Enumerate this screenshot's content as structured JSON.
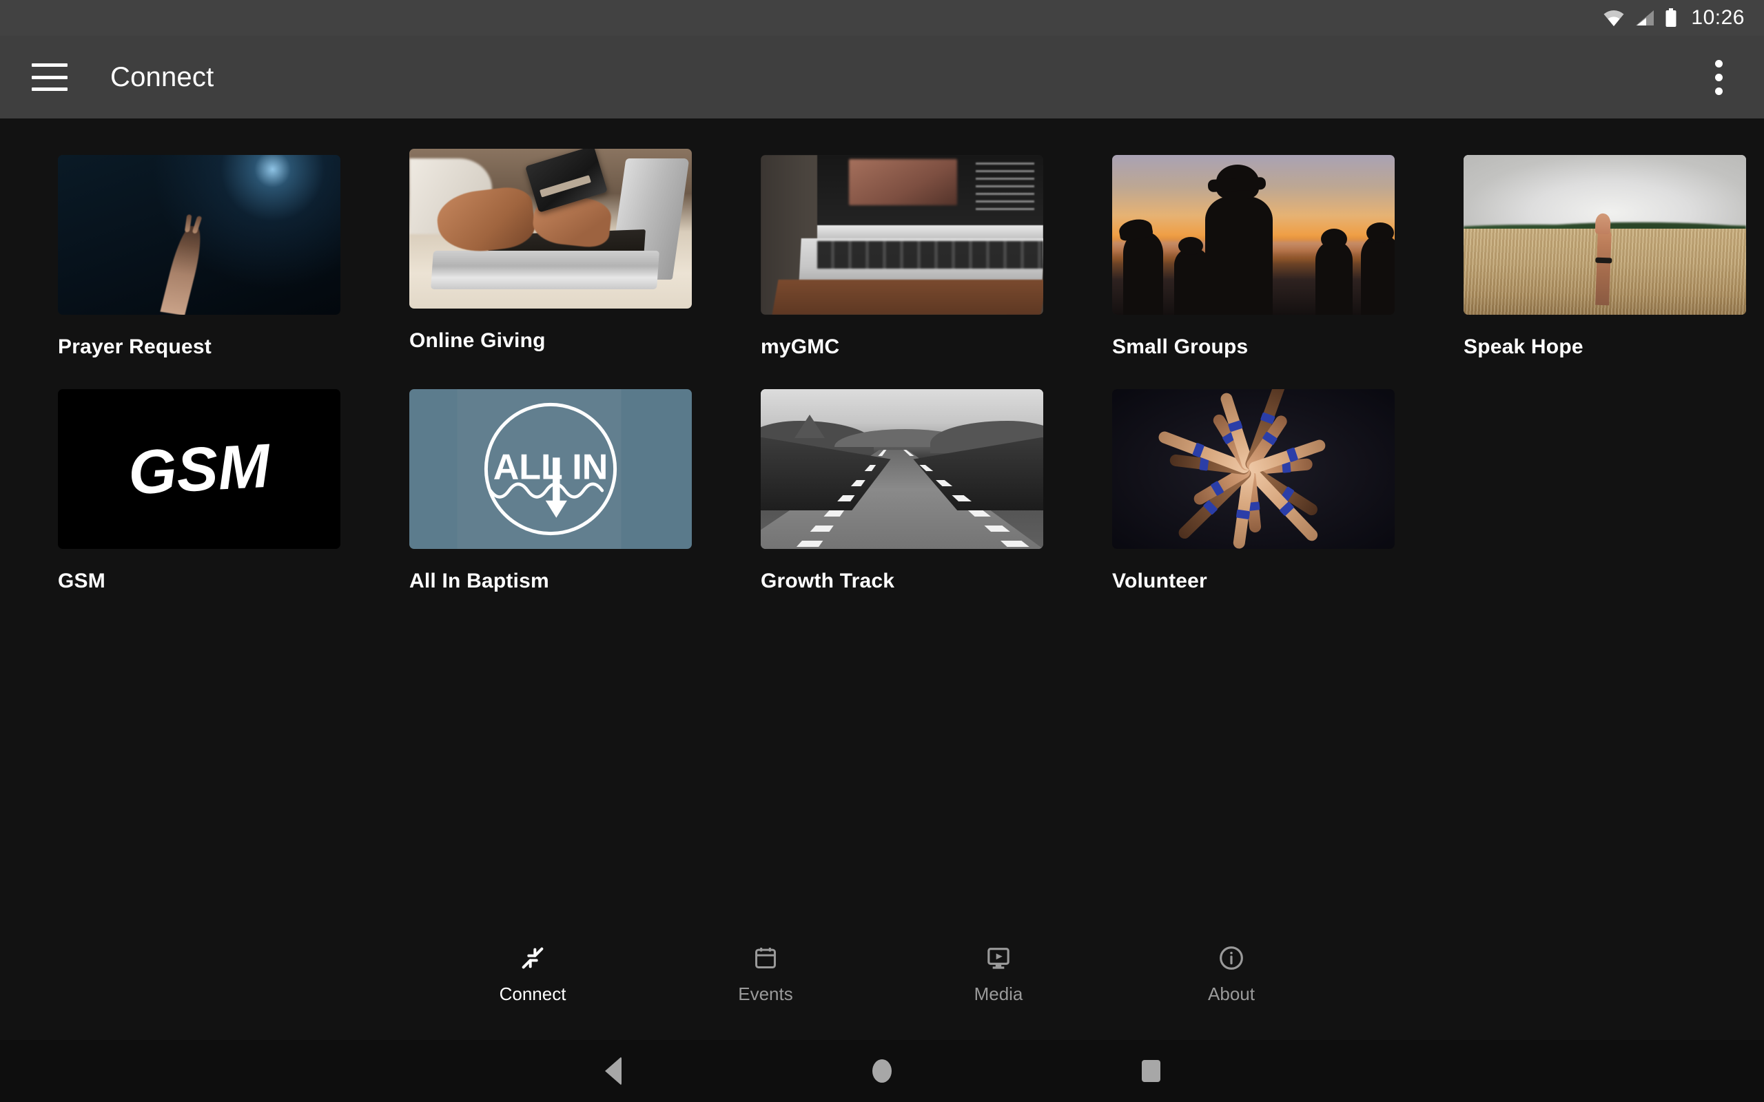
{
  "status_bar": {
    "time": "10:26",
    "icons": [
      "wifi-icon",
      "cellular-signal-icon",
      "battery-icon"
    ]
  },
  "app_bar": {
    "menu_icon": "hamburger-menu-icon",
    "title": "Connect",
    "overflow_icon": "overflow-menu-icon"
  },
  "tiles": [
    {
      "label": "Prayer Request",
      "art": "art-prayer",
      "col": "col-a"
    },
    {
      "label": "Online Giving",
      "art": "art-give",
      "col": "col-b"
    },
    {
      "label": "myGMC",
      "art": "art-mygmc",
      "col": "col-a"
    },
    {
      "label": "Small Groups",
      "art": "art-small",
      "col": "col-c"
    },
    {
      "label": "Speak Hope",
      "art": "art-hope",
      "col": "col-c"
    },
    {
      "label": "GSM",
      "art": "art-gsm",
      "col": "col-a"
    },
    {
      "label": "All In Baptism",
      "art": "art-allin",
      "col": "col-b"
    },
    {
      "label": "Growth Track",
      "art": "art-growth",
      "col": "col-a"
    },
    {
      "label": "Volunteer",
      "art": "art-vol",
      "col": "col-c"
    }
  ],
  "tile_art_text": {
    "gsm_logo": "GSM",
    "allin_logo_line": "ALL IN"
  },
  "bottom_nav": {
    "items": [
      {
        "label": "Connect",
        "icon": "connect-arrows-icon",
        "active": true
      },
      {
        "label": "Events",
        "icon": "calendar-icon",
        "active": false
      },
      {
        "label": "Media",
        "icon": "media-player-icon",
        "active": false
      },
      {
        "label": "About",
        "icon": "info-circle-icon",
        "active": false
      }
    ]
  },
  "system_nav": {
    "back": "back-triangle-icon",
    "home": "home-circle-icon",
    "recents": "recents-square-icon"
  },
  "colors": {
    "status_bar_bg": "#424242",
    "app_bar_bg": "#3f3f3f",
    "content_bg": "#121212",
    "active_nav": "#ffffff",
    "inactive_nav": "#9a9a9a",
    "allin_bg": "#627f8f"
  }
}
